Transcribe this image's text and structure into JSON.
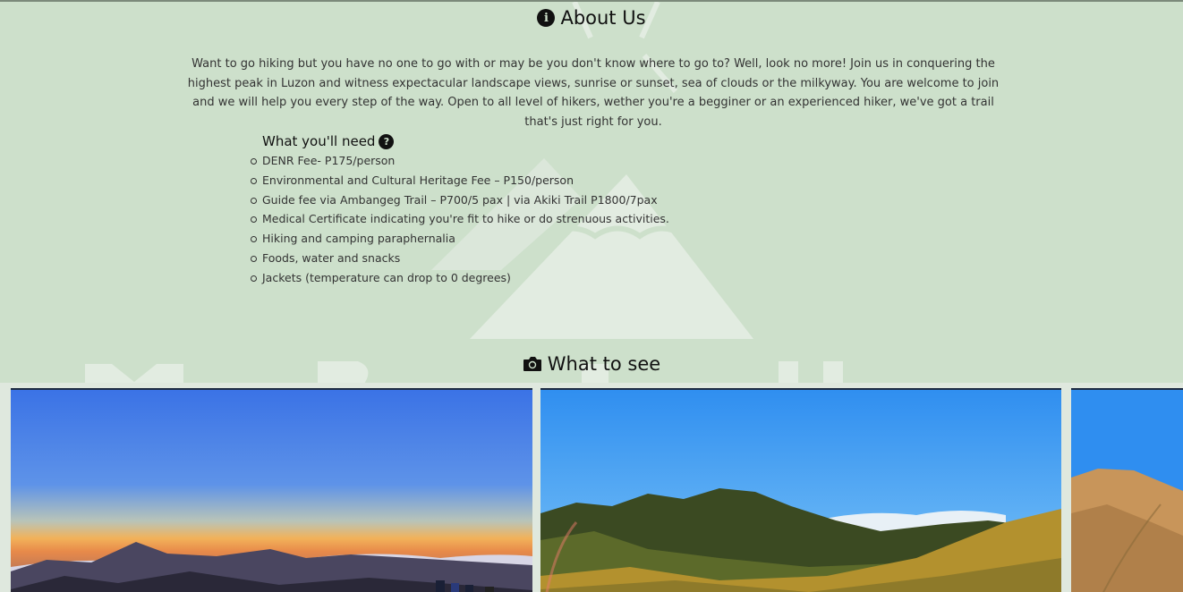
{
  "about": {
    "title": "About Us",
    "icon": "info-circle-icon",
    "text": "Want to go hiking but you have no one to go with or may be you don't know where to go to? Well, look no more! Join us in conquering the highest peak in Luzon and witness expectacular landscape views, sunrise or sunset, sea of clouds or the milkyway. You are welcome to join and we will help you every step of the way. Open to all level of hikers, wether you're a begginer or an experienced hiker, we've got a trail that's just right for you."
  },
  "need": {
    "title": "What you'll need",
    "icon": "question-circle-icon",
    "items": [
      "DENR Fee- P175/person",
      "Environmental and Cultural Heritage Fee – P150/person",
      "Guide fee via Ambangeg Trail – P700/5 pax | via Akiki Trail P1800/7pax",
      "Medical Certificate indicating you're fit to hike or do strenuous activities.",
      "Hiking and camping paraphernalia",
      "Foods, water and snacks",
      "Jackets (temperature can drop to 0 degrees)"
    ]
  },
  "see": {
    "title": "What to see",
    "icon": "camera-icon"
  },
  "colors": {
    "background": "#cde0cb",
    "watermark": "#e2ece1"
  }
}
